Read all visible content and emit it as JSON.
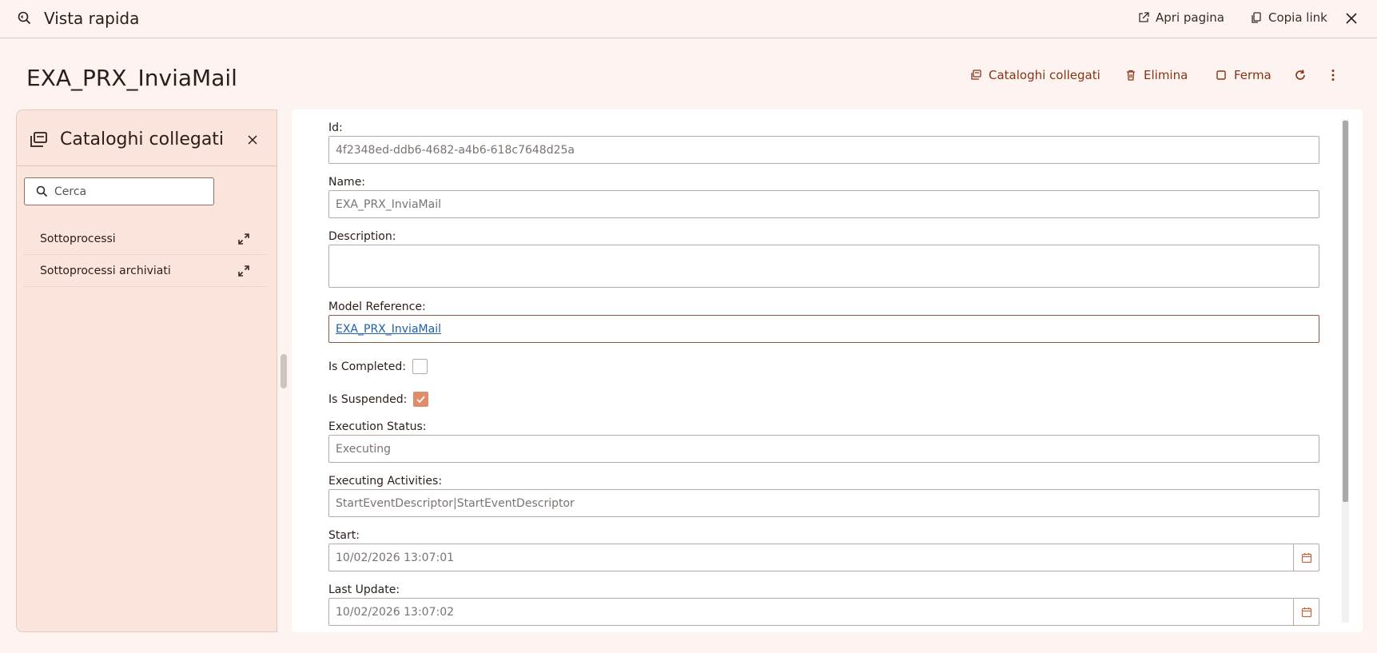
{
  "topbar": {
    "title": "Vista rapida",
    "open_page": "Apri pagina",
    "copy_link": "Copia link"
  },
  "header": {
    "title": "EXA_PRX_InviaMail",
    "actions": {
      "linked_catalogs": "Cataloghi collegati",
      "delete": "Elimina",
      "stop": "Ferma"
    }
  },
  "left_panel": {
    "title": "Cataloghi collegati",
    "search_placeholder": "Cerca",
    "items": [
      {
        "label": "Sottoprocessi"
      },
      {
        "label": "Sottoprocessi archiviati"
      }
    ]
  },
  "form": {
    "id": {
      "label": "Id:",
      "value": "4f2348ed-ddb6-4682-a4b6-618c7648d25a"
    },
    "name": {
      "label": "Name:",
      "value": "EXA_PRX_InviaMail"
    },
    "description": {
      "label": "Description:",
      "value": ""
    },
    "model_reference": {
      "label": "Model Reference:",
      "value": "EXA_PRX_InviaMail"
    },
    "is_completed": {
      "label": "Is Completed:",
      "checked": false
    },
    "is_suspended": {
      "label": "Is Suspended:",
      "checked": true
    },
    "execution_status": {
      "label": "Execution Status:",
      "value": "Executing"
    },
    "executing_activities": {
      "label": "Executing Activities:",
      "value": "StartEventDescriptor|StartEventDescriptor"
    },
    "start": {
      "label": "Start:",
      "value": "10/02/2026 13:07:01"
    },
    "last_update": {
      "label": "Last Update:",
      "value": "10/02/2026 13:07:02"
    }
  },
  "colors": {
    "background": "#fdf3f0",
    "accent": "#8a3312",
    "checkbox_checked": "#e08b6a",
    "link": "#1d5fa8"
  }
}
